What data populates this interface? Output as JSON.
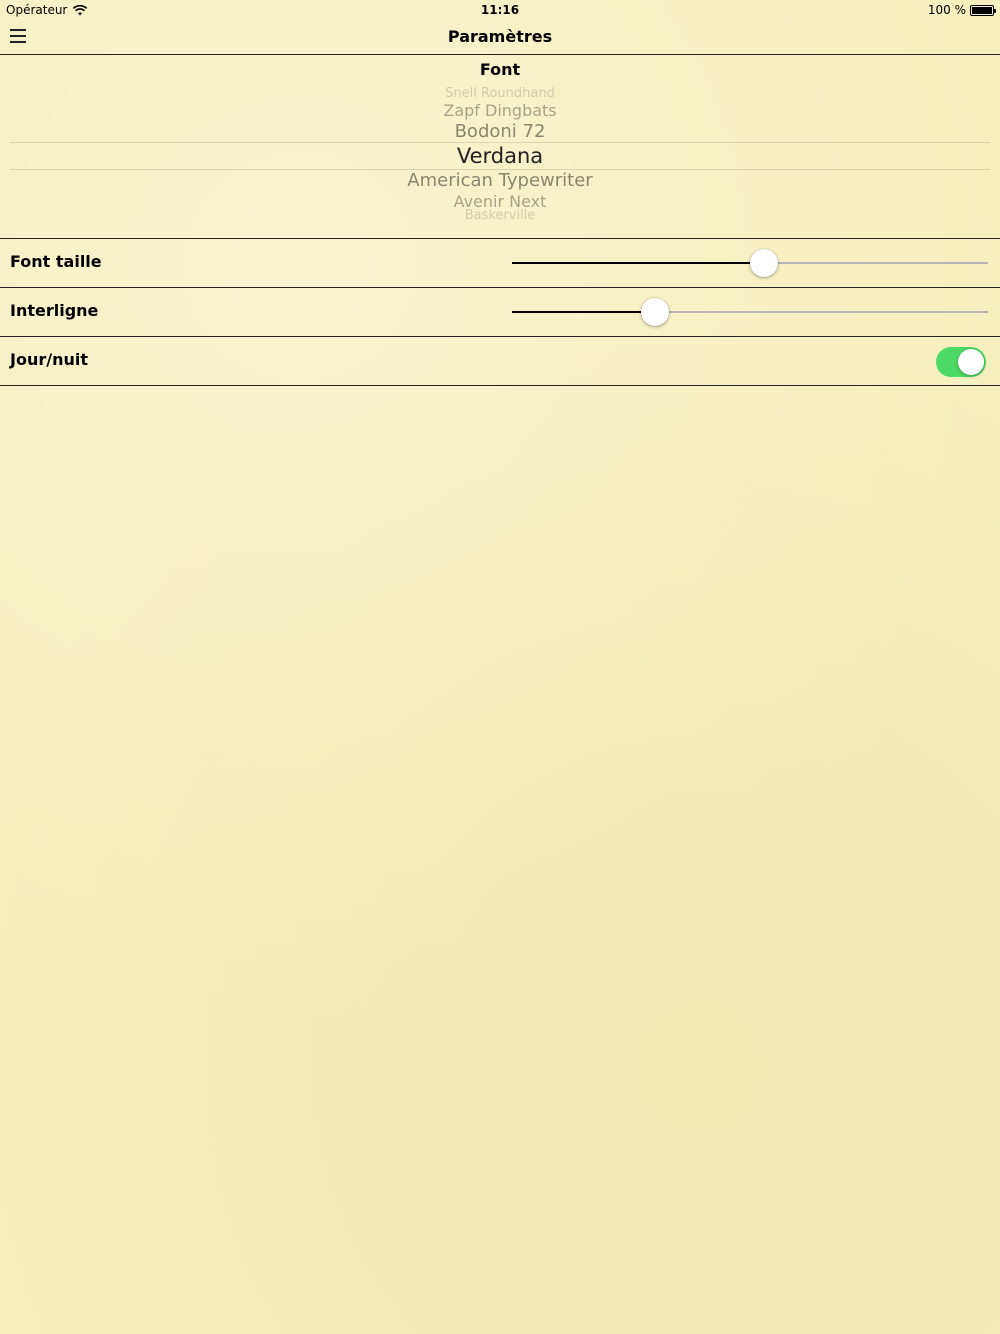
{
  "status_bar": {
    "carrier": "Opérateur",
    "time": "11:16",
    "battery_text": "100 %",
    "battery_level": 1.0
  },
  "navbar": {
    "title": "Paramètres",
    "menu_icon": "hamburger-menu-icon"
  },
  "font_section": {
    "label": "Font",
    "picker_items": [
      "Snell Roundhand",
      "Zapf Dingbats",
      "Bodoni 72",
      "Verdana",
      "American Typewriter",
      "Avenir Next",
      "Baskerville"
    ],
    "selected": "Verdana"
  },
  "settings": {
    "font_size": {
      "label": "Font taille",
      "value": 0.53
    },
    "line_spacing": {
      "label": "Interligne",
      "value": 0.3
    },
    "day_night": {
      "label": "Jour/nuit",
      "on": true
    }
  },
  "colors": {
    "background": "#f6efbf",
    "toggle_on": "#4cd964"
  }
}
